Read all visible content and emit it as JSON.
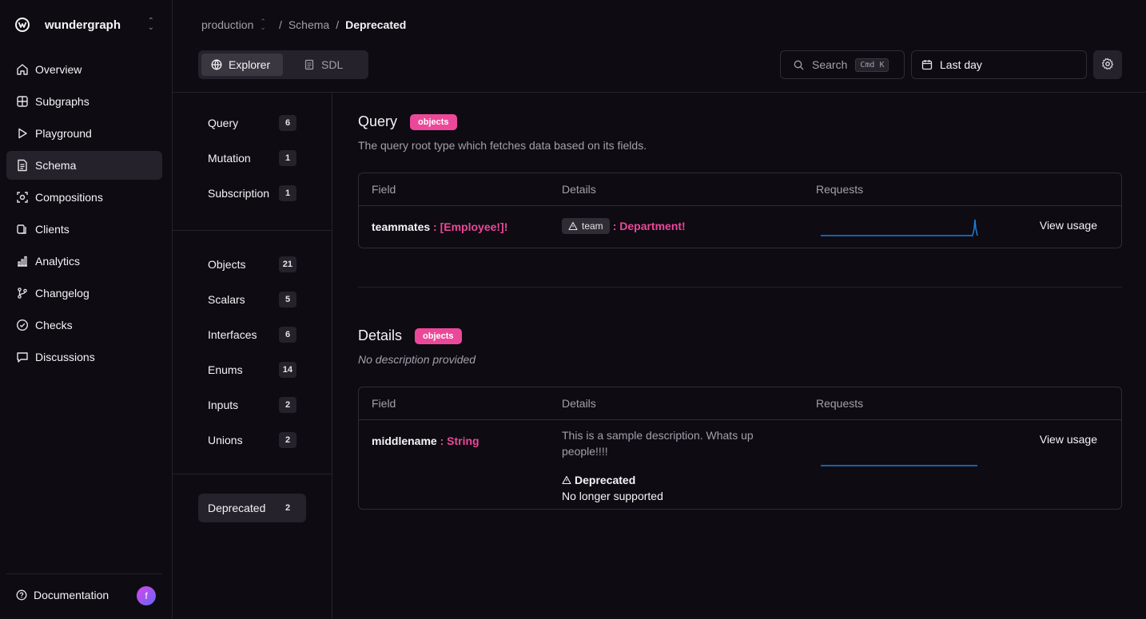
{
  "brand": {
    "name": "wundergraph"
  },
  "nav": {
    "items": [
      {
        "label": "Overview",
        "icon": "home-icon"
      },
      {
        "label": "Subgraphs",
        "icon": "grid-icon"
      },
      {
        "label": "Playground",
        "icon": "play-icon"
      },
      {
        "label": "Schema",
        "icon": "file-icon",
        "active": true
      },
      {
        "label": "Compositions",
        "icon": "component-icon"
      },
      {
        "label": "Clients",
        "icon": "clients-icon"
      },
      {
        "label": "Analytics",
        "icon": "bar-chart-icon"
      },
      {
        "label": "Changelog",
        "icon": "git-branch-icon"
      },
      {
        "label": "Checks",
        "icon": "check-circle-icon"
      },
      {
        "label": "Discussions",
        "icon": "message-icon"
      }
    ],
    "footer": {
      "documentation": "Documentation",
      "avatar_initial": "f"
    }
  },
  "breadcrumb": {
    "namespace": "production",
    "section": "Schema",
    "current": "Deprecated"
  },
  "tabs": {
    "explorer": "Explorer",
    "sdl": "SDL"
  },
  "toolbar": {
    "search_label": "Search",
    "search_shortcut": "Cmd K",
    "date_range": "Last day"
  },
  "subnav": {
    "roots": [
      {
        "label": "Query",
        "count": "6"
      },
      {
        "label": "Mutation",
        "count": "1"
      },
      {
        "label": "Subscription",
        "count": "1"
      }
    ],
    "types": [
      {
        "label": "Objects",
        "count": "21"
      },
      {
        "label": "Scalars",
        "count": "5"
      },
      {
        "label": "Interfaces",
        "count": "6"
      },
      {
        "label": "Enums",
        "count": "14"
      },
      {
        "label": "Inputs",
        "count": "2"
      },
      {
        "label": "Unions",
        "count": "2"
      }
    ],
    "deprecated": {
      "label": "Deprecated",
      "count": "2"
    }
  },
  "sections": [
    {
      "title": "Query",
      "badge": "objects",
      "description": "The query root type which fetches data based on its fields.",
      "columns": {
        "field": "Field",
        "details": "Details",
        "requests": "Requests"
      },
      "row": {
        "field": "teammates",
        "type": ": [Employee!]!",
        "arg_name": "team",
        "arg_type": ": Department!",
        "action": "View usage"
      }
    },
    {
      "title": "Details",
      "badge": "objects",
      "description": "No description provided",
      "columns": {
        "field": "Field",
        "details": "Details",
        "requests": "Requests"
      },
      "row": {
        "field": "middlename",
        "type": ": String",
        "description": "This is a sample description. Whats up people!!!!",
        "deprecated_label": "Deprecated",
        "deprecated_reason": "No longer supported",
        "action": "View usage"
      }
    }
  ],
  "colors": {
    "accent": "#ec4899",
    "sparkline": "#1d7ed8",
    "background": "#0e0b13"
  }
}
